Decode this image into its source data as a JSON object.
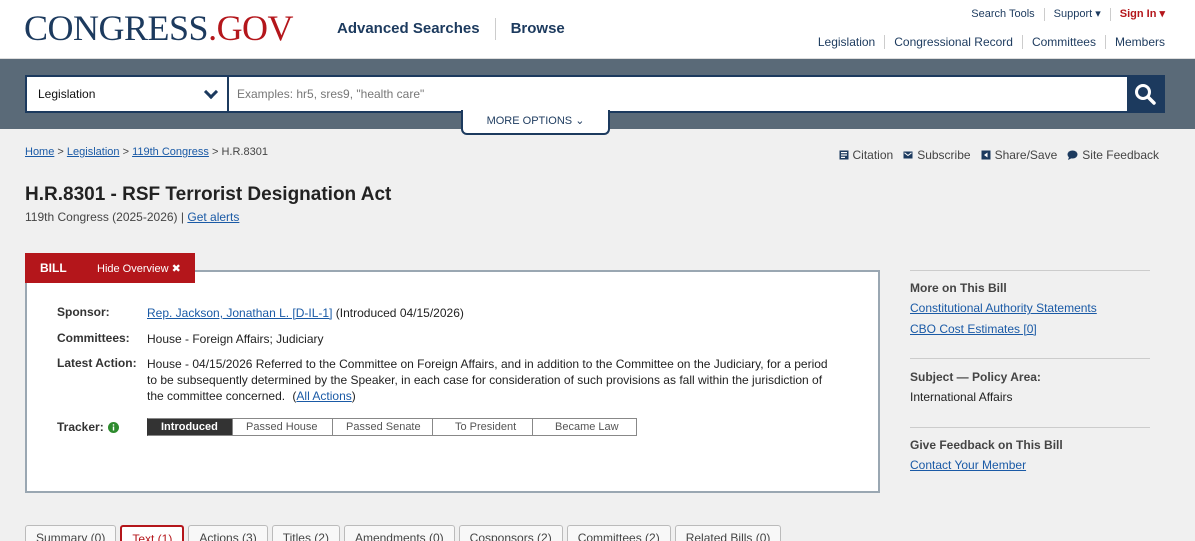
{
  "header": {
    "logo_main": "CONGRESS",
    "logo_dot": ".",
    "logo_gov": "GOV",
    "nav": [
      "Advanced Searches",
      "Browse"
    ],
    "util": [
      "Search Tools",
      "Support ▾",
      "Sign In ▾"
    ],
    "subnav": [
      "Legislation",
      "Congressional Record",
      "Committees",
      "Members"
    ]
  },
  "search": {
    "collection": "Legislation",
    "placeholder": "Examples: hr5, sres9, \"health care\"",
    "more_options": "MORE OPTIONS ⌄"
  },
  "breadcrumb": {
    "items": [
      "Home",
      "Legislation",
      "119th Congress"
    ],
    "current": "H.R.8301",
    "sep": ">"
  },
  "tools": [
    "Citation",
    "Subscribe",
    "Share/Save",
    "Site Feedback"
  ],
  "bill": {
    "title": "H.R.8301 - RSF Terrorist Designation Act",
    "congress": "119th Congress (2025-2026)",
    "sep": "|",
    "get_alerts": "Get alerts",
    "tab_label": "BILL",
    "hide_overview": "Hide Overview ✖",
    "sponsor_label": "Sponsor:",
    "sponsor_link": "Rep. Jackson, Jonathan L. [D-IL-1]",
    "sponsor_intro": "(Introduced 04/15/2026)",
    "committees_label": "Committees:",
    "committees": "House - Foreign Affairs; Judiciary",
    "latest_label": "Latest Action:",
    "latest_action": "House - 04/15/2026 Referred to the Committee on Foreign Affairs, and in addition to the Committee on the Judiciary, for a period to be subsequently determined by the Speaker, in each case for consideration of such provisions as fall within the jurisdiction of the committee concerned.",
    "all_actions_open": "(",
    "all_actions": "All Actions",
    "all_actions_close": ")",
    "tracker_label": "Tracker:",
    "tracker": [
      "Introduced",
      "Passed House",
      "Passed Senate",
      "To President",
      "Became Law"
    ]
  },
  "side": {
    "more_heading": "More on This Bill",
    "more_links": [
      "Constitutional Authority Statements",
      "CBO Cost Estimates [0]"
    ],
    "subject_heading": "Subject — Policy Area:",
    "subject_value": "International Affairs",
    "feedback_heading": "Give Feedback on This Bill",
    "feedback_link": "Contact Your Member"
  },
  "tabs": [
    "Summary (0)",
    "Text (1)",
    "Actions (3)",
    "Titles (2)",
    "Amendments (0)",
    "Cosponsors (2)",
    "Committees (2)",
    "Related Bills (0)"
  ],
  "colors": {
    "navy": "#1c3a5e",
    "red": "#b4161b",
    "link": "#1a5aa6"
  }
}
